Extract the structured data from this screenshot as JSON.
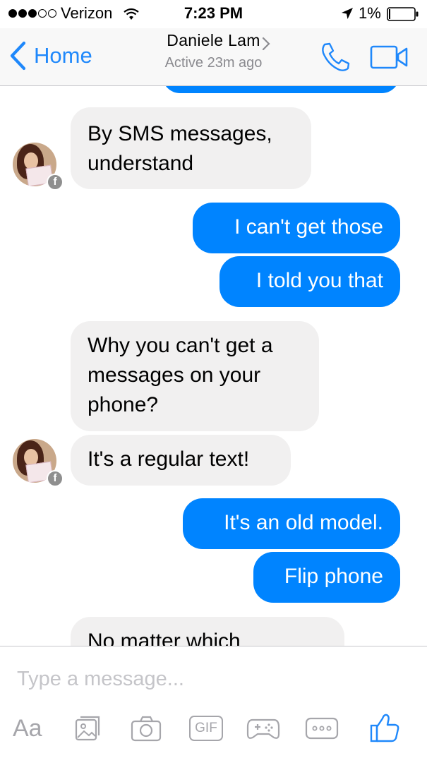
{
  "status_bar": {
    "carrier": "Verizon",
    "time": "7:23 PM",
    "battery": "1%",
    "signal_bars_filled": 3,
    "signal_bars_total": 5
  },
  "nav": {
    "back_label": "Home",
    "contact_name": "Daniele Lam",
    "contact_status": "Active 23m ago"
  },
  "messages": [
    {
      "from": "them",
      "text_lines": [
        "By SMS messages,",
        "understand"
      ]
    },
    {
      "from": "me",
      "text": "I can't get those"
    },
    {
      "from": "me",
      "text": "I told you that"
    },
    {
      "from": "them",
      "text_lines": [
        "Why you can't get a",
        "messages on your",
        "phone?"
      ]
    },
    {
      "from": "them",
      "text": "It's a regular text!"
    },
    {
      "from": "me",
      "text": "It's an old model."
    },
    {
      "from": "me",
      "text": "Flip phone"
    },
    {
      "from": "them",
      "text": "No matter which"
    }
  ],
  "composer": {
    "placeholder": "Type a message...",
    "aa_label": "Aa",
    "gif_label": "GIF",
    "toolbar_icons": [
      "text-format-icon",
      "photo-icon",
      "camera-icon",
      "gif-icon",
      "game-icon",
      "more-icon",
      "like-icon"
    ]
  },
  "colors": {
    "accent": "#1f88fb",
    "outgoing_bubble": "#0084ff",
    "incoming_bubble": "#f1f0f0"
  }
}
